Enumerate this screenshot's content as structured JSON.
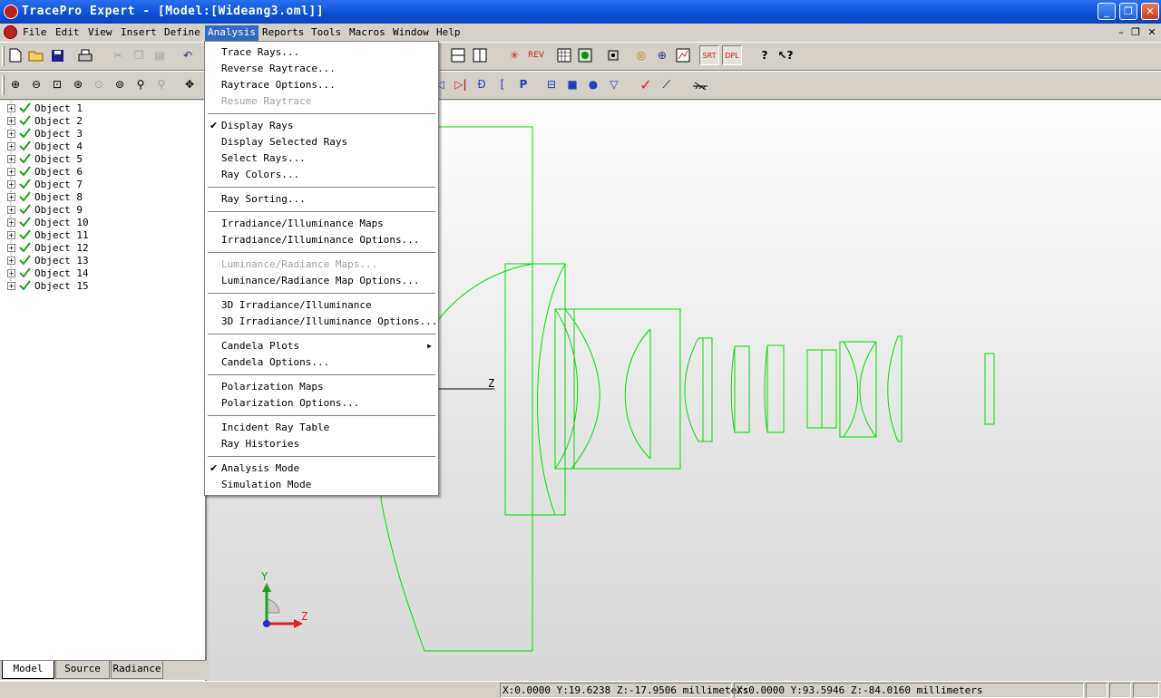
{
  "titlebar": {
    "title": "TracePro Expert - [Model:[Wideang3.oml]]"
  },
  "menubar": {
    "items": [
      "File",
      "Edit",
      "View",
      "Insert",
      "Define",
      "Analysis",
      "Reports",
      "Tools",
      "Macros",
      "Window",
      "Help"
    ],
    "active": "Analysis"
  },
  "tree": {
    "items": [
      "Object 1",
      "Object 2",
      "Object 3",
      "Object 4",
      "Object 5",
      "Object 6",
      "Object 7",
      "Object 8",
      "Object 9",
      "Object 10",
      "Object 11",
      "Object 12",
      "Object 13",
      "Object 14",
      "Object 15"
    ]
  },
  "tabs": [
    "Model",
    "Source",
    "Radiance"
  ],
  "analysis_menu": {
    "items": [
      {
        "label": "Trace Rays...",
        "enabled": true,
        "checked": false
      },
      {
        "label": "Reverse Raytrace...",
        "enabled": true,
        "checked": false
      },
      {
        "label": "Raytrace Options...",
        "enabled": true,
        "checked": false
      },
      {
        "label": "Resume Raytrace",
        "enabled": false,
        "checked": false
      },
      {
        "label": "Display Rays",
        "enabled": true,
        "checked": true
      },
      {
        "label": "Display Selected Rays",
        "enabled": true,
        "checked": false
      },
      {
        "label": "Select Rays...",
        "enabled": true,
        "checked": false
      },
      {
        "label": "Ray Colors...",
        "enabled": true,
        "checked": false
      },
      {
        "label": "Ray Sorting...",
        "enabled": true,
        "checked": false
      },
      {
        "label": "Irradiance/Illuminance Maps",
        "enabled": true,
        "checked": false
      },
      {
        "label": "Irradiance/Illuminance Options...",
        "enabled": true,
        "checked": false
      },
      {
        "label": "Luminance/Radiance Maps...",
        "enabled": false,
        "checked": false
      },
      {
        "label": "Luminance/Radiance Map Options...",
        "enabled": true,
        "checked": false
      },
      {
        "label": "3D Irradiance/Illuminance",
        "enabled": true,
        "checked": false
      },
      {
        "label": "3D Irradiance/Illuminance Options...",
        "enabled": true,
        "checked": false
      },
      {
        "label": "Candela Plots",
        "enabled": true,
        "checked": false,
        "submenu": true
      },
      {
        "label": "Candela Options...",
        "enabled": true,
        "checked": false
      },
      {
        "label": "Polarization Maps",
        "enabled": true,
        "checked": false
      },
      {
        "label": "Polarization Options...",
        "enabled": true,
        "checked": false
      },
      {
        "label": "Incident Ray Table",
        "enabled": true,
        "checked": false
      },
      {
        "label": "Ray Histories",
        "enabled": true,
        "checked": false
      },
      {
        "label": "Analysis Mode",
        "enabled": true,
        "checked": true
      },
      {
        "label": "Simulation Mode",
        "enabled": true,
        "checked": false
      }
    ]
  },
  "viewport": {
    "axis_label_z": "Z",
    "triad_y": "Y",
    "triad_z": "Z",
    "geometry_color": "#00e000"
  },
  "statusbar": {
    "coord1": "X:0.0000 Y:19.6238 Z:-17.9506 millimeters",
    "coord2": "X:0.0000 Y:93.5946 Z:-84.0160 millimeters"
  },
  "colors": {
    "titlebar": "#0a4fd6",
    "menu_highlight": "#316ac5",
    "face": "#d4d0c8"
  }
}
